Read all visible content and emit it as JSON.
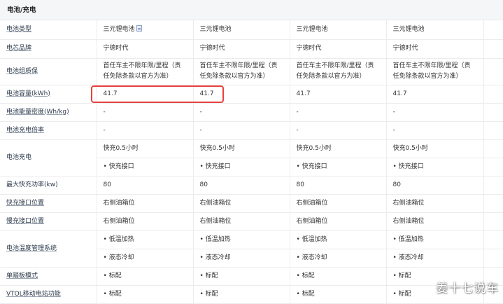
{
  "section_title": "电池/充电",
  "rows": [
    {
      "label": "电池类型",
      "link": true,
      "cells": [
        "三元锂电池",
        "三元锂电池",
        "三元锂电池",
        "三元锂电池"
      ]
    },
    {
      "label": "电芯品牌",
      "link": true,
      "cells": [
        "宁德时代",
        "宁德时代",
        "宁德时代",
        "宁德时代"
      ]
    },
    {
      "label": "电池组质保",
      "link": true,
      "cells": [
        "首任车主不限年限/里程（责任免除条款以官方为准）",
        "首任车主不限年限/里程（责任免除条款以官方为准）",
        "首任车主不限年限/里程（责任免除条款以官方为准）",
        "首任车主不限年限/里程（责任免除条款以官方为准）"
      ]
    },
    {
      "label": "电池容量(kWh)",
      "link": true,
      "cells": [
        "41.7",
        "41.7",
        "41.7",
        "41.7"
      ]
    },
    {
      "label": "电池能量密度(Wh/kg)",
      "link": true,
      "cells": [
        "-",
        "-",
        "-",
        "-"
      ]
    },
    {
      "label": "电池充电倍率",
      "link": true,
      "cells": [
        "-",
        "-",
        "-",
        "-"
      ]
    },
    {
      "label": "电池充电",
      "link": false,
      "cells": [
        "快充0.5小时",
        "快充0.5小时",
        "快充0.5小时",
        "快充0.5小时"
      ]
    },
    {
      "label": "",
      "link": false,
      "cells": [
        "• 快充接口",
        "• 快充接口",
        "• 快充接口",
        "• 快充接口"
      ]
    },
    {
      "label": "最大快充功率(kw)",
      "link": false,
      "cells": [
        "80",
        "80",
        "80",
        "80"
      ]
    },
    {
      "label": "快充接口位置",
      "link": true,
      "cells": [
        "右侧油箱位",
        "右侧油箱位",
        "右侧油箱位",
        "右侧油箱位"
      ]
    },
    {
      "label": "慢充接口位置",
      "link": true,
      "cells": [
        "右侧油箱位",
        "右侧油箱位",
        "右侧油箱位",
        "右侧油箱位"
      ]
    },
    {
      "label": "电池温度管理系统",
      "link": true,
      "cells": [
        "• 低温加热",
        "• 低温加热",
        "• 低温加热",
        "• 低温加热"
      ]
    },
    {
      "label": "",
      "link": false,
      "cells": [
        "• 液态冷却",
        "• 液态冷却",
        "• 液态冷却",
        "• 液态冷却"
      ]
    },
    {
      "label": "单踏板模式",
      "link": true,
      "cells": [
        "• 标配",
        "• 标配",
        "• 标配",
        "• 标配"
      ]
    },
    {
      "label": "VTOL移动电站功能",
      "link": true,
      "cells": [
        "• 标配",
        "• 标配",
        "• 标配",
        "• 标配"
      ]
    }
  ],
  "watermark": "姜十七说车"
}
